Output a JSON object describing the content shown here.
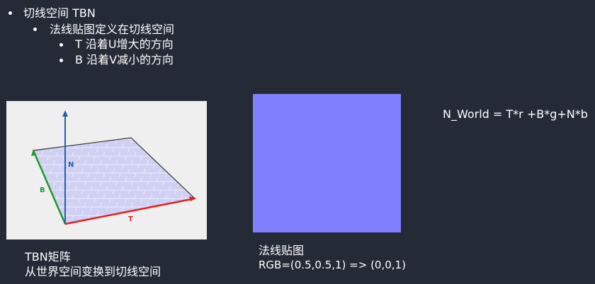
{
  "bullets": {
    "level1": "切线空间 TBN",
    "level2": "法线贴图定义在切线空间",
    "level3_t": "T 沿着U增大的方向",
    "level3_b": "B 沿着V减小的方向"
  },
  "figure": {
    "label_n": "N",
    "label_b": "B",
    "label_t": "T",
    "colors": {
      "n_axis": "#1f5fb0",
      "b_axis": "#1e9a2e",
      "t_axis": "#e02020",
      "plane": "#c8c8f0"
    }
  },
  "captions": {
    "tbn_title": "TBN矩阵",
    "tbn_desc": "从世界空间变换到切线空间",
    "normal_title": "法线贴图",
    "normal_desc": "RGB=(0.5,0.5,1) => (0,0,1)"
  },
  "normal_map": {
    "color": "#8080ff"
  },
  "formula": "N_World = T*r +B*g+N*b"
}
